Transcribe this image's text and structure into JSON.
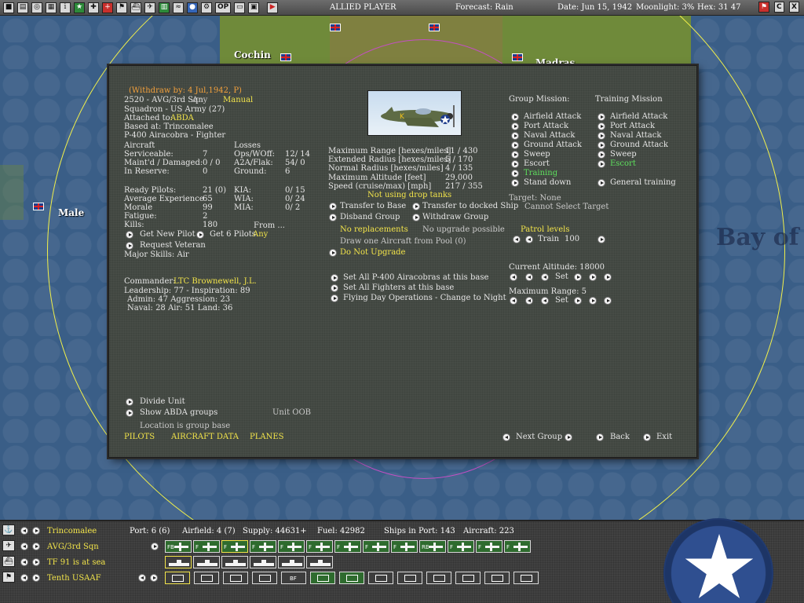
{
  "topbar": {
    "player": "ALLIED PLAYER",
    "forecast": "Forecast: Rain",
    "date": "Date: Jun 15, 1942",
    "moonlight": "Moonlight: 3%",
    "hex": "Hex: 31 47",
    "op_label": "OP",
    "c_label": "C",
    "x_label": "X",
    "icons": [
      "save-icon",
      "file-icon",
      "globe-icon",
      "report-icon",
      "info-icon",
      "star-icon",
      "cross-icon",
      "plus-icon",
      "flag-icon",
      "ship-icon",
      "aircraft-icon",
      "chart-icon",
      "fleet-icon",
      "earth-icon",
      "gear-icon",
      "op-icon",
      "screen-icon",
      "disk-icon",
      "play-icon"
    ]
  },
  "map": {
    "labels": [
      "Cochin",
      "Madras",
      "Male",
      "Bay of"
    ]
  },
  "panel": {
    "withdraw": "(Withdraw by: 4 Jul,1942, P)",
    "group_name": "2520 - AVG/3rd Sqn",
    "group_any": "Any",
    "group_manual": "Manual",
    "squadron": "Squadron - US Army (27)",
    "attached_label": "Attached to:",
    "attached_value": "ABDA",
    "based_at": "Based at: Trincomalee",
    "aircraft_type": "P-400 Airacobra - Fighter",
    "aircraft_header": "Aircraft",
    "serviceable_label": "Serviceable:",
    "serviceable_value": "7",
    "maintd_label": "Maint'd / Damaged:",
    "maintd_value": "0 / 0",
    "reserve_label": "In Reserve:",
    "reserve_value": "0",
    "losses_header": "Losses",
    "opswoff_label": "Ops/WOff:",
    "opswoff_value": "12/ 14",
    "a2a_label": "A2A/Flak:",
    "a2a_value": "54/ 0",
    "ground_label": "Ground:",
    "ground_value": "6",
    "ready_label": "Ready Pilots:",
    "ready_value": "21 (0)",
    "exp_label": "Average Experience",
    "exp_value": "65",
    "morale_label": "Morale",
    "morale_value": "99",
    "fatigue_label": "Fatigue:",
    "fatigue_value": "2",
    "kills_label": "Kills:",
    "kills_value": "180",
    "kia_label": "KIA:",
    "kia_value": "0/ 15",
    "wia_label": "WIA:",
    "wia_value": "0/ 24",
    "mia_label": "MIA:",
    "mia_value": "0/ 2",
    "from_label": "From ...",
    "get_new_pilot": "Get New Pilot",
    "get_6_pilots": "Get 6 Pilots",
    "get_any": "Any",
    "request_veteran": "Request Veteran",
    "major_skills": "Major Skills:  Air",
    "commander_label": "Commander:",
    "commander_value": "LTC Brownewell, J.L.",
    "leadership": "Leadership: 77 - Inspiration: 89",
    "admin": "Admin: 47  Aggression: 23",
    "naval": "Naval: 28  Air: 51  Land: 36",
    "stats": [
      {
        "label": "Maximum Range [hexes/miles]",
        "value": "11 / 430"
      },
      {
        "label": "Extended Radius [hexes/miles]",
        "value": "5 / 170"
      },
      {
        "label": "Normal Radius [hexes/miles]",
        "value": "4 / 135"
      },
      {
        "label": "Maximum Altitude [feet]",
        "value": "29,000"
      },
      {
        "label": "Speed (cruise/max) [mph]",
        "value": "217 / 355"
      }
    ],
    "drop_tanks": "Not using drop tanks",
    "transfer_base": "Transfer to Base",
    "transfer_ship": "Transfer to docked Ship",
    "disband": "Disband Group",
    "withdraw_group": "Withdraw Group",
    "no_replacements": "No replacements",
    "no_upgrade": "No upgrade possible",
    "draw_one": "Draw one Aircraft from Pool (0)",
    "do_not_upgrade": "Do Not Upgrade",
    "set_all_p400": "Set All P-400 Airacobras at this base",
    "set_all_fighters": "Set All Fighters at this base",
    "flying_day": "Flying Day Operations - Change to Night",
    "group_mission_header": "Group Mission:",
    "training_mission_header": "Training Mission",
    "group_missions": [
      "Airfield Attack",
      "Port Attack",
      "Naval Attack",
      "Ground Attack",
      "Sweep",
      "Escort",
      "Training",
      "Stand down"
    ],
    "training_missions": [
      "Airfield Attack",
      "Port Attack",
      "Naval Attack",
      "Ground Attack",
      "Sweep",
      "Escort"
    ],
    "general_training": "General training",
    "target": "Target: None",
    "cannot_select": "Cannot Select Target",
    "patrol_levels": "Patrol levels",
    "train_label": "Train",
    "train_value": "100",
    "current_altitude": "Current Altitude: 18000",
    "set_label": "Set",
    "maximum_range": "Maximum Range: 5",
    "set_label2": "Set",
    "divide_unit": "Divide Unit",
    "show_abda": "Show ABDA groups",
    "unit_oob": "Unit OOB",
    "location": "Location is group base",
    "tab_pilots": "PILOTS",
    "tab_aircraft_data": "AIRCRAFT DATA",
    "tab_planes": "PLANES",
    "next_group": "Next Group",
    "back": "Back",
    "exit": "Exit"
  },
  "bottombar": {
    "base_name": "Trincomalee",
    "port": "Port: 6 (6)",
    "airfield": "Airfield: 4 (7)",
    "supply": "Supply: 44631+",
    "fuel": "Fuel: 42982",
    "ships_in_port": "Ships in Port: 143",
    "aircraft": "Aircraft: 223",
    "group_name": "AVG/3rd Sqn",
    "tf_name": "TF 91 is at sea",
    "hq_name": "Tenth USAAF",
    "air_chips": [
      "FB",
      "F",
      "F",
      "F",
      "F",
      "F",
      "F",
      "F",
      "F",
      "RE",
      "F",
      "F",
      "F"
    ],
    "unit_chips": [
      "",
      "",
      "",
      "",
      "BF",
      "",
      "",
      "",
      "",
      "",
      "",
      "",
      ""
    ]
  },
  "colors": {
    "panel_bg": "#474c46",
    "highlight_yellow": "#f2e44a",
    "withdraw_orange": "#f2a03c",
    "selected_green": "#5de05d",
    "ocean": "#3d5f86"
  }
}
